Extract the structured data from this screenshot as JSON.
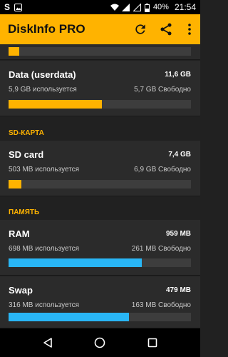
{
  "status_bar": {
    "battery": "40%",
    "time": "21:54"
  },
  "app_bar": {
    "title": "DiskInfo PRO"
  },
  "colors": {
    "accent": "#FFB300",
    "memory_bar": "#29B6F6",
    "track": "#3d3d3d"
  },
  "top_partial": {
    "usage_fraction": 0.06
  },
  "partitions": [
    {
      "name": "Data (userdata)",
      "total": "11,6 GB",
      "used": "5,9 GB используется",
      "free": "5,7 GB Свободно",
      "usage_fraction": 0.51,
      "bar_color": "#FFB300"
    }
  ],
  "sd_section": {
    "label": "SD-КАРТА"
  },
  "sd_cards": [
    {
      "name": "SD card",
      "total": "7,4 GB",
      "used": "503 MB используется",
      "free": "6,9 GB Свободно",
      "usage_fraction": 0.07,
      "bar_color": "#FFB300"
    }
  ],
  "memory_section": {
    "label": "ПАМЯТЬ"
  },
  "memory": [
    {
      "name": "RAM",
      "total": "959 MB",
      "used": "698 MB используется",
      "free": "261 MB Свободно",
      "usage_fraction": 0.73,
      "bar_color": "#29B6F6"
    },
    {
      "name": "Swap",
      "total": "479 MB",
      "used": "316 MB используется",
      "free": "163 MB Свободно",
      "usage_fraction": 0.66,
      "bar_color": "#29B6F6"
    }
  ]
}
